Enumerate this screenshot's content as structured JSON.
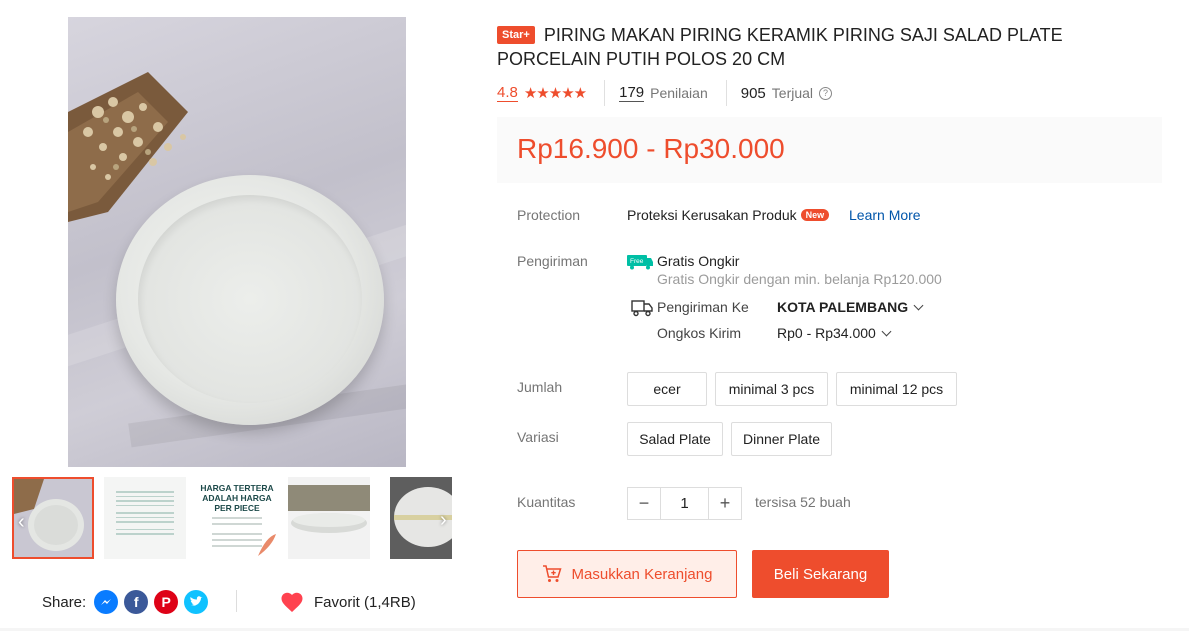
{
  "product": {
    "badge": "Star+",
    "title": "PIRING MAKAN PIRING KERAMIK PIRING SAJI SALAD PLATE PORCELAIN PUTIH POLOS 20 CM",
    "rating": "4.8",
    "stars": "★★★★★",
    "review_count": "179",
    "review_label": "Penilaian",
    "sold_count": "905",
    "sold_label": "Terjual",
    "price": "Rp16.900 - Rp30.000"
  },
  "thumbnail_text": {
    "t3_heading": "HARGA TERTERA ADALAH HARGA PER PIECE"
  },
  "protection": {
    "label": "Protection",
    "value": "Proteksi Kerusakan Produk",
    "badge": "New",
    "link": "Learn More"
  },
  "shipping": {
    "label": "Pengiriman",
    "free_icon_text": "Free",
    "free_title": "Gratis Ongkir",
    "free_desc": "Gratis Ongkir dengan min. belanja Rp120.000",
    "to_label": "Pengiriman Ke",
    "to_value": "KOTA PALEMBANG",
    "cost_label": "Ongkos Kirim",
    "cost_value": "Rp0 - Rp34.000"
  },
  "jumlah": {
    "label": "Jumlah",
    "options": [
      "ecer",
      "minimal 3 pcs",
      "minimal 12 pcs"
    ]
  },
  "variasi": {
    "label": "Variasi",
    "options": [
      "Salad Plate",
      "Dinner Plate"
    ]
  },
  "quantity": {
    "label": "Kuantitas",
    "minus": "−",
    "value": "1",
    "plus": "+",
    "stock": "tersisa 52 buah"
  },
  "actions": {
    "add_to_cart": "Masukkan Keranjang",
    "buy_now": "Beli Sekarang"
  },
  "share": {
    "label": "Share:",
    "facebook_glyph": "f",
    "pinterest_glyph": "P"
  },
  "favorite": {
    "label": "Favorit (1,4RB)"
  },
  "colors": {
    "accent": "#ee4d2d",
    "link": "#0055aa"
  }
}
